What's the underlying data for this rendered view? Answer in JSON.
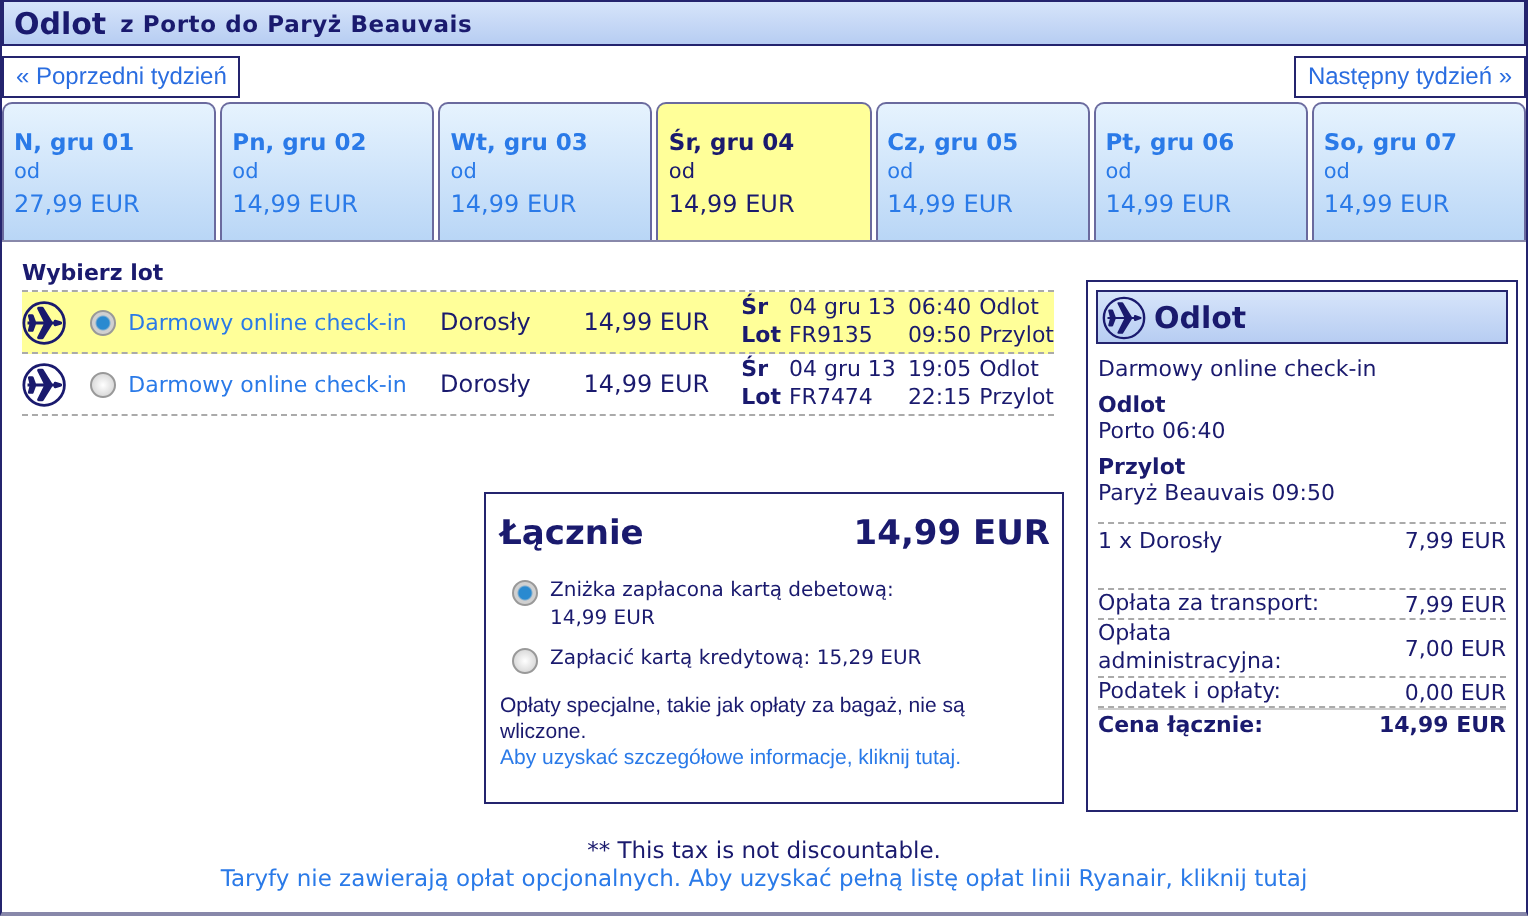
{
  "header": {
    "title": "Odlot",
    "route": "z Porto do Paryż Beauvais"
  },
  "nav": {
    "prev": "« Poprzedni tydzień",
    "next": "Następny tydzień »"
  },
  "days": [
    {
      "day": "N, gru 01",
      "from": "od",
      "price": "27,99 EUR",
      "selected": false
    },
    {
      "day": "Pn, gru 02",
      "from": "od",
      "price": "14,99 EUR",
      "selected": false
    },
    {
      "day": "Wt, gru 03",
      "from": "od",
      "price": "14,99 EUR",
      "selected": false
    },
    {
      "day": "Śr, gru 04",
      "from": "od",
      "price": "14,99 EUR",
      "selected": true
    },
    {
      "day": "Cz, gru 05",
      "from": "od",
      "price": "14,99 EUR",
      "selected": false
    },
    {
      "day": "Pt, gru 06",
      "from": "od",
      "price": "14,99 EUR",
      "selected": false
    },
    {
      "day": "So, gru 07",
      "from": "od",
      "price": "14,99 EUR",
      "selected": false
    }
  ],
  "flights_title": "Wybierz lot",
  "flights": [
    {
      "selected": true,
      "checkin": "Darmowy online check-in",
      "passenger": "Dorosły",
      "price": "14,99 EUR",
      "day": "Śr",
      "date": "04 gru 13",
      "dep_time": "06:40",
      "dep_label": "Odlot",
      "flight_label": "Lot",
      "flight_no": "FR9135",
      "arr_time": "09:50",
      "arr_label": "Przylot"
    },
    {
      "selected": false,
      "checkin": "Darmowy online check-in",
      "passenger": "Dorosły",
      "price": "14,99 EUR",
      "day": "Śr",
      "date": "04 gru 13",
      "dep_time": "19:05",
      "dep_label": "Odlot",
      "flight_label": "Lot",
      "flight_no": "FR7474",
      "arr_time": "22:15",
      "arr_label": "Przylot"
    }
  ],
  "total": {
    "label": "Łącznie",
    "amount": "14,99 EUR",
    "payments": [
      {
        "text": "Zniżka zapłacona kartą debetową: 14,99 EUR",
        "selected": true
      },
      {
        "text": "Zapłacić kartą kredytową: 15,29 EUR",
        "selected": false
      }
    ],
    "note": "Opłaty specjalne, takie jak opłaty za bagaż, nie są wliczone.",
    "note_link": "Aby uzyskać szczegółowe informacje, kliknij tutaj."
  },
  "summary": {
    "title": "Odlot",
    "checkin": "Darmowy online check-in",
    "dep_label": "Odlot",
    "dep_value": "Porto 06:40",
    "arr_label": "Przylot",
    "arr_value": "Paryż Beauvais 09:50",
    "lines": [
      {
        "label": "1 x Dorosły",
        "value": "7,99 EUR"
      },
      {
        "label": "Opłata za transport:",
        "value": "7,99 EUR"
      },
      {
        "label": "Opłata administracyjna:",
        "value": "7,00 EUR"
      },
      {
        "label": "Podatek i opłaty:",
        "value": "0,00 EUR"
      }
    ],
    "total_label": "Cena łącznie:",
    "total_value": "14,99 EUR"
  },
  "tax_note": "** This tax is not discountable.",
  "footer_link": "Taryfy nie zawierają opłat opcjonalnych. Aby uzyskać pełną listę opłat linii Ryanair, kliknij tutaj"
}
